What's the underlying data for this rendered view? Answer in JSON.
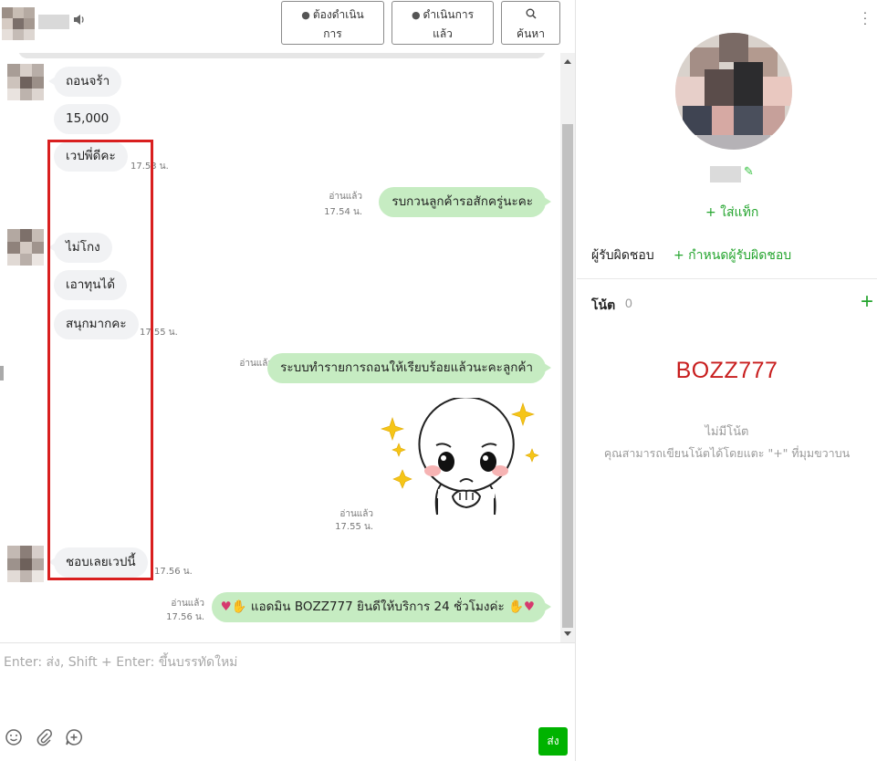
{
  "header": {
    "buttons": {
      "todo": [
        "ต้องดำเนิน",
        "การ"
      ],
      "done": [
        "ดำเนินการ",
        "แล้ว"
      ],
      "search": "ค้นหา"
    }
  },
  "messages": {
    "in1": "ถอนจร้า",
    "in2": "15,000",
    "in3": "เวปพี่ดีคะ",
    "time_in3": "17.53 น.",
    "read1": "อ่านแล้ว",
    "time_out1": "17.54 น.",
    "out1": "รบกวนลูกค้ารอสักครู่นะคะ",
    "in4": "ไม่โกง",
    "in5": "เอาทุนได้",
    "in6": "สนุกมากคะ",
    "time_in6": "17.55 น.",
    "read2": "อ่านแล้ว",
    "out2": "ระบบทำรายการถอนให้เรียบร้อยแล้วนะคะลูกค้า",
    "read3": "อ่านแล้ว",
    "time_sticker": "17.55 น.",
    "in7": "ชอบเลยเวปนี้",
    "time_in7": "17.56 น.",
    "read4": "อ่านแล้ว",
    "time_out3": "17.56 น.",
    "out3": "แอดมิน BOZZ777 ยินดีให้บริการ 24 ชั่วโมงค่ะ"
  },
  "composer": {
    "placeholder": "Enter: ส่ง, Shift + Enter: ขึ้นบรรทัดใหม่",
    "send": "ส่ง"
  },
  "profile": {
    "add_tag": "+ ใส่แท็ก",
    "assignee_label": "ผู้รับผิดชอบ",
    "assignee_link": "+ กำหนดผู้รับผิดชอบ",
    "notes_title": "โน้ต",
    "notes_count": "0",
    "notes_add": "+",
    "brand": "BOZZ777",
    "empty_title": "ไม่มีโน้ต",
    "empty_desc": "คุณสามารถเขียนโน้ตได้โดยแตะ \"+\" ที่มุมขวาบน"
  },
  "colors": {
    "accent_green": "#25a52f",
    "send_green": "#00b300",
    "out_bubble": "#c6ecc2",
    "in_bubble": "#f1f2f4",
    "highlight_red": "#d91f1f",
    "brand_red": "#c81e1e"
  }
}
